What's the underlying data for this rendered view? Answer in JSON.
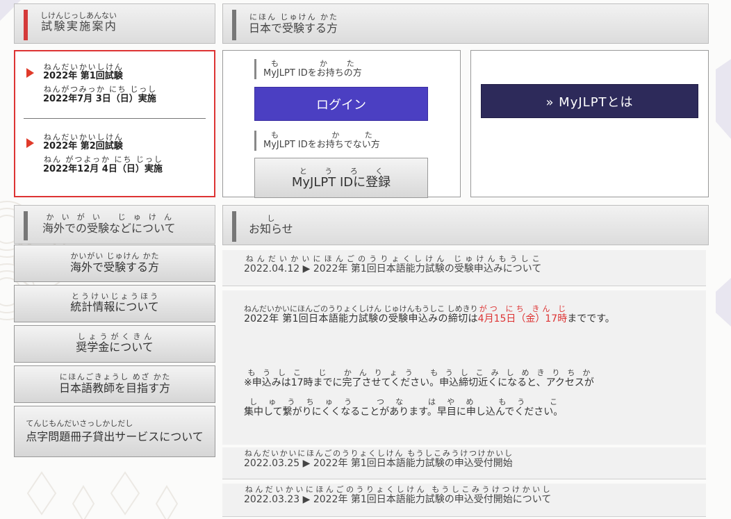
{
  "exam_info": {
    "header": "試験実施案内",
    "header_ruby": "しけんじっしあんない",
    "schedule": [
      {
        "title": "2022年 第1回試験",
        "title_ruby": "ねんだいかいしけん",
        "date": "2022年7月 3日（日）実施",
        "date_ruby": "ねんがつみっか にち じっし"
      },
      {
        "title": "2022年 第2回試験",
        "title_ruby": "ねんだいかいしけん",
        "date": "2022年12月 4日（日）実施",
        "date_ruby": "ねん がつよっか にち じっし"
      }
    ]
  },
  "domestic": {
    "header": "日本で受験する方",
    "header_ruby": "にほん じゅけん かた",
    "have_id_label": "MyJLPT IDをお持ちの方",
    "have_id_ruby": "も かた",
    "login_label": "ログイン",
    "no_id_label": "MyJLPT IDをお持ちでない方",
    "no_id_ruby": "も かた",
    "register_label": "MyJLPT IDに登録",
    "register_ruby": "とうろく",
    "about_label": "» MyJLPTとは"
  },
  "overseas": {
    "header": "海外での受験などについて",
    "header_ruby": "かいがい じゅけん",
    "nav": [
      {
        "label": "海外で受験する方",
        "ruby": "かいがい じゅけん かた"
      },
      {
        "label": "統計情報について",
        "ruby": "とうけいじょうほう"
      },
      {
        "label": "奨学金について",
        "ruby": "しょうがくきん"
      },
      {
        "label": "日本語教師を目指す方",
        "ruby": "にほんごきょうし めざ かた"
      },
      {
        "label": "点字問題冊子貸出サービスについて",
        "ruby": "てんじもんだいさっしかしだし"
      }
    ]
  },
  "news": {
    "header": "お知らせ",
    "header_ruby": "し",
    "items": [
      {
        "text": "2022.04.12 ▶ 2022年 第1回日本語能力試験の受験申込みについて",
        "ruby": "ねんだいかいにほんごのうりょくしけん じゅけんもうしこ"
      },
      {
        "text": "2022.03.25 ▶ 2022年 第1回日本語能力試験の申込受付開始",
        "ruby": "ねんだいかいにほんごのうりょくしけん もうしこみうけつけかいし"
      },
      {
        "text": "2022.03.23 ▶ 2022年 第1回日本語能力試験の申込受付開始について",
        "ruby": "ねんだいかいにほんごのうりょくしけん もうしこみうけつけかいし"
      }
    ],
    "notice": {
      "p1_pre": "2022年 第1回日本語能力試験の受験申込みの締切は",
      "p1_pre_ruby": "ねんだいかいにほんごのうりょくしけん じゅけんもうしこ しめきり",
      "p1_deadline": "4月15日（金）17時",
      "p1_deadline_ruby": "がつ にち きん じ",
      "p1_post": "までです。",
      "p2_line1": "※申込みは17時までに完了させてください。申込締切近くになると、アクセスが",
      "p2_line1_ruby": "もうしこ じ かんりょう もうしこみしめきりちか",
      "p2_line2": "集中して繋がりにくくなることがあります。早目に申し込んでください。",
      "p2_line2_ruby": "しゅうちゅう つな はやめ もう こ"
    }
  },
  "colors": {
    "accent_red": "#dd3333",
    "login_blue": "#4b3fc2",
    "about_navy": "#2d2a5a"
  }
}
